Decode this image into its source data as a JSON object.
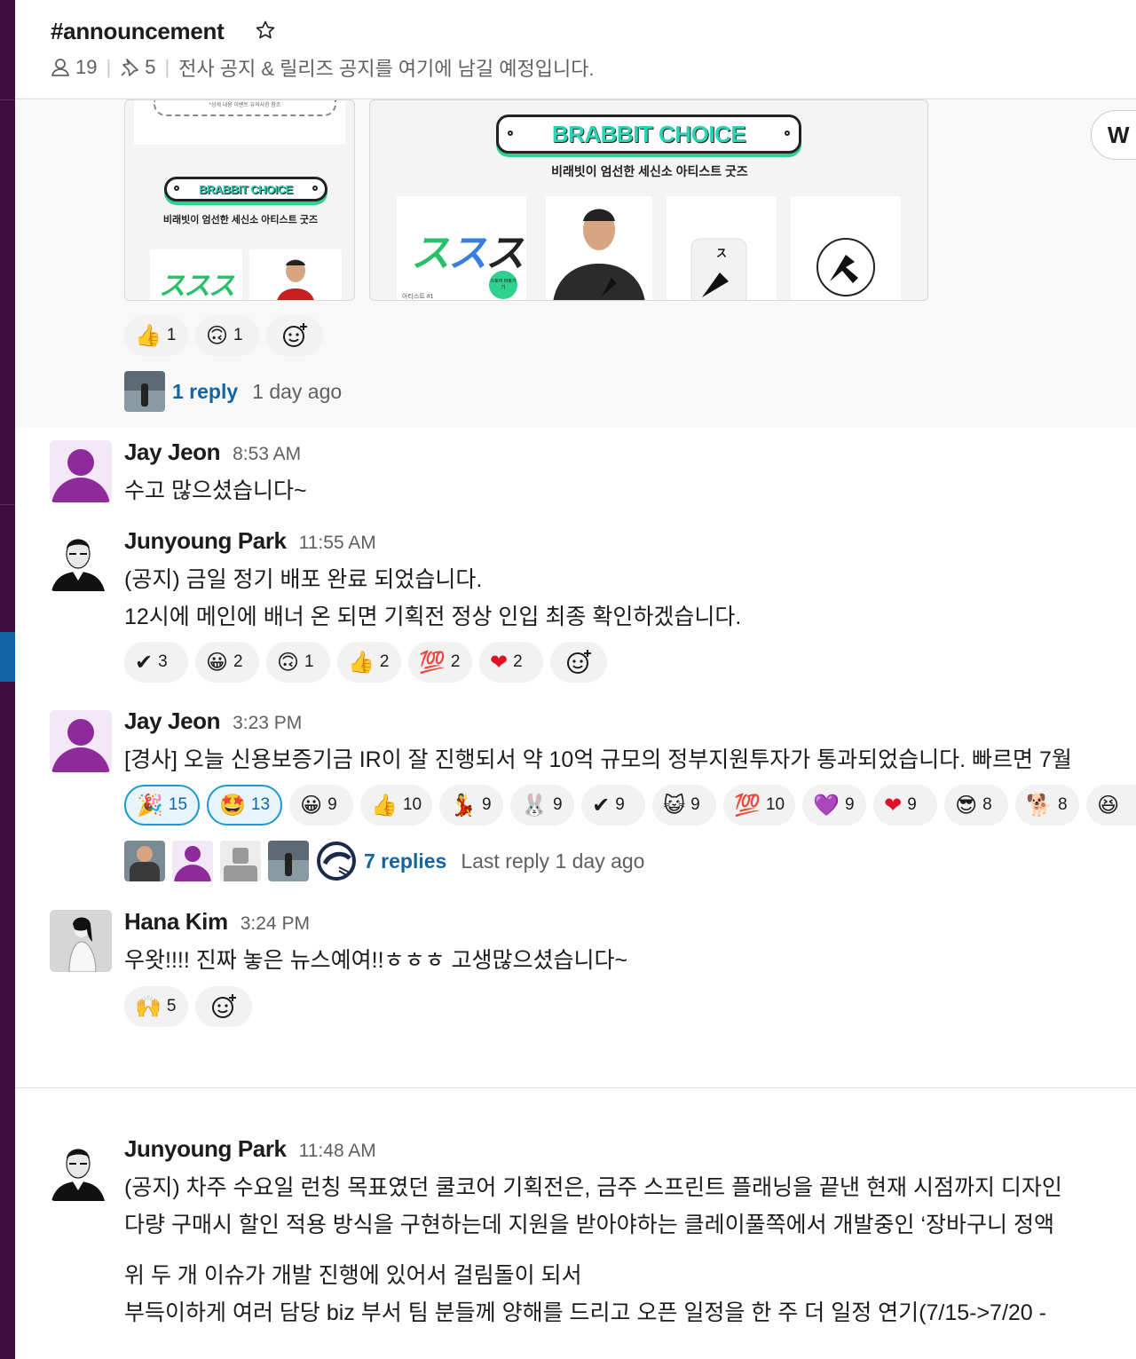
{
  "channel": {
    "name": "#announcement",
    "members": "19",
    "pins": "5",
    "topic": "전사 공지 & 릴리즈 공지를 여기에 남길 예정입니다."
  },
  "attachment": {
    "pill_text": "BRABBIT CHOICE",
    "subtitle": "비래빗이 엄선한 세신소 아티스트 굿즈",
    "goods_text": "ススス",
    "artist_label": "아티스트 #1",
    "small_button": "스토어 바로가기",
    "tiny_note": "*상세 내용 이벤트 유의사항 참조",
    "tab_letter": "W"
  },
  "top_reactions": [
    {
      "emoji": "👍",
      "count": "1"
    },
    {
      "emoji": "🙃",
      "count": "1"
    }
  ],
  "top_thread": {
    "link": "1 reply",
    "meta": "1 day ago"
  },
  "messages": [
    {
      "name": "Jay Jeon",
      "time": "8:53 AM",
      "lines": [
        "수고 많으셨습니다~"
      ]
    },
    {
      "name": "Junyoung Park",
      "time": "11:55 AM",
      "lines": [
        "(공지) 금일 정기 배포 완료 되었습니다.",
        "12시에 메인에 배너 온 되면 기획전 정상 인입 최종 확인하겠습니다."
      ],
      "reactions": [
        {
          "emoji": "✔",
          "count": "3"
        },
        {
          "emoji": "😀",
          "count": "2"
        },
        {
          "emoji": "🙃",
          "count": "1"
        },
        {
          "emoji": "👍",
          "count": "2"
        },
        {
          "emoji": "💯",
          "count": "2"
        },
        {
          "emoji": "❤",
          "count": "2"
        }
      ]
    },
    {
      "name": "Jay Jeon",
      "time": "3:23 PM",
      "lines": [
        "[경사] 오늘 신용보증기금 IR이 잘 진행되서 약 10억 규모의 정부지원투자가 통과되었습니다. 빠르면 7월"
      ],
      "reactions": [
        {
          "emoji": "🎉",
          "count": "15",
          "mine": true
        },
        {
          "emoji": "🤩",
          "count": "13",
          "mine": true
        },
        {
          "emoji": "😀",
          "count": "9"
        },
        {
          "emoji": "👍",
          "count": "10"
        },
        {
          "emoji": "💃",
          "count": "9"
        },
        {
          "emoji": "🐰",
          "count": "9"
        },
        {
          "emoji": "✔",
          "count": "9"
        },
        {
          "emoji": "😺",
          "count": "9"
        },
        {
          "emoji": "💯",
          "count": "10"
        },
        {
          "emoji": "💜",
          "count": "9"
        },
        {
          "emoji": "❤",
          "count": "9"
        },
        {
          "emoji": "😎",
          "count": "8"
        },
        {
          "emoji": "🐕",
          "count": "8"
        },
        {
          "emoji": "😆",
          "count": ""
        }
      ],
      "thread": {
        "link": "7 replies",
        "meta": "Last reply 1 day ago"
      }
    },
    {
      "name": "Hana Kim",
      "time": "3:24 PM",
      "lines": [
        "우왓!!!! 진짜 놓은 뉴스예여!!ㅎㅎㅎ 고생많으셨습니다~"
      ],
      "reactions": [
        {
          "emoji": "🙌",
          "count": "5"
        }
      ]
    },
    {
      "name": "Junyoung Park",
      "time": "11:48 AM",
      "lines": [
        "(공지) 차주 수요일 런칭 목표였던 쿨코어 기획전은, 금주 스프린트 플래닝을 끝낸 현재 시점까지 디자인",
        "다량 구매시 할인 적용 방식을 구현하는데 지원을 받아야하는 클레이풀쪽에서 개발중인 ‘장바구니 정액",
        "위 두 개 이슈가 개발 진행에 있어서 걸림돌이 되서",
        "부득이하게 여러 담당 biz 부서 팀 분들께 양해를 드리고 오픈 일정을 한 주 더 일정 연기(7/15->7/20 -"
      ]
    }
  ]
}
